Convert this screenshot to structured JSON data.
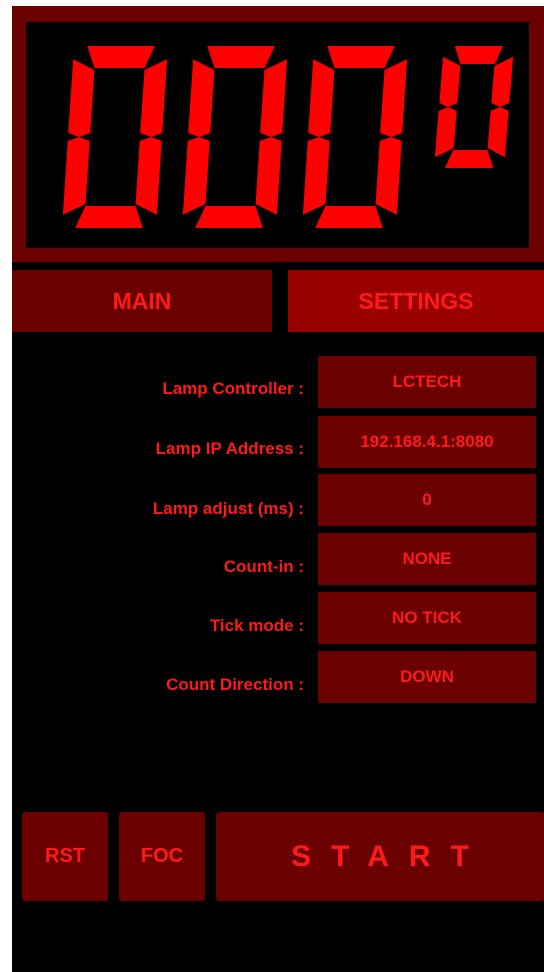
{
  "display": {
    "value": "000",
    "degree_symbol": "0",
    "segment_color": "#ff0000"
  },
  "tabs": [
    {
      "label": "MAIN",
      "active": false
    },
    {
      "label": "SETTINGS",
      "active": true
    }
  ],
  "settings": [
    {
      "label": "Lamp Controller :",
      "value": "LCTECH"
    },
    {
      "label": "Lamp IP Address :",
      "value": "192.168.4.1:8080"
    },
    {
      "label": "Lamp adjust (ms) :",
      "value": "0"
    },
    {
      "label": "Count-in :",
      "value": "NONE"
    },
    {
      "label": "Tick mode :",
      "value": "NO TICK"
    },
    {
      "label": "Count Direction :",
      "value": "DOWN"
    }
  ],
  "buttons": {
    "rst": "RST",
    "foc": "FOC",
    "start": "START"
  },
  "colors": {
    "text_red": "#ff1a1a",
    "panel_dark_red": "#6a0000",
    "active_tab_red": "#9a0000",
    "background": "#000000"
  }
}
